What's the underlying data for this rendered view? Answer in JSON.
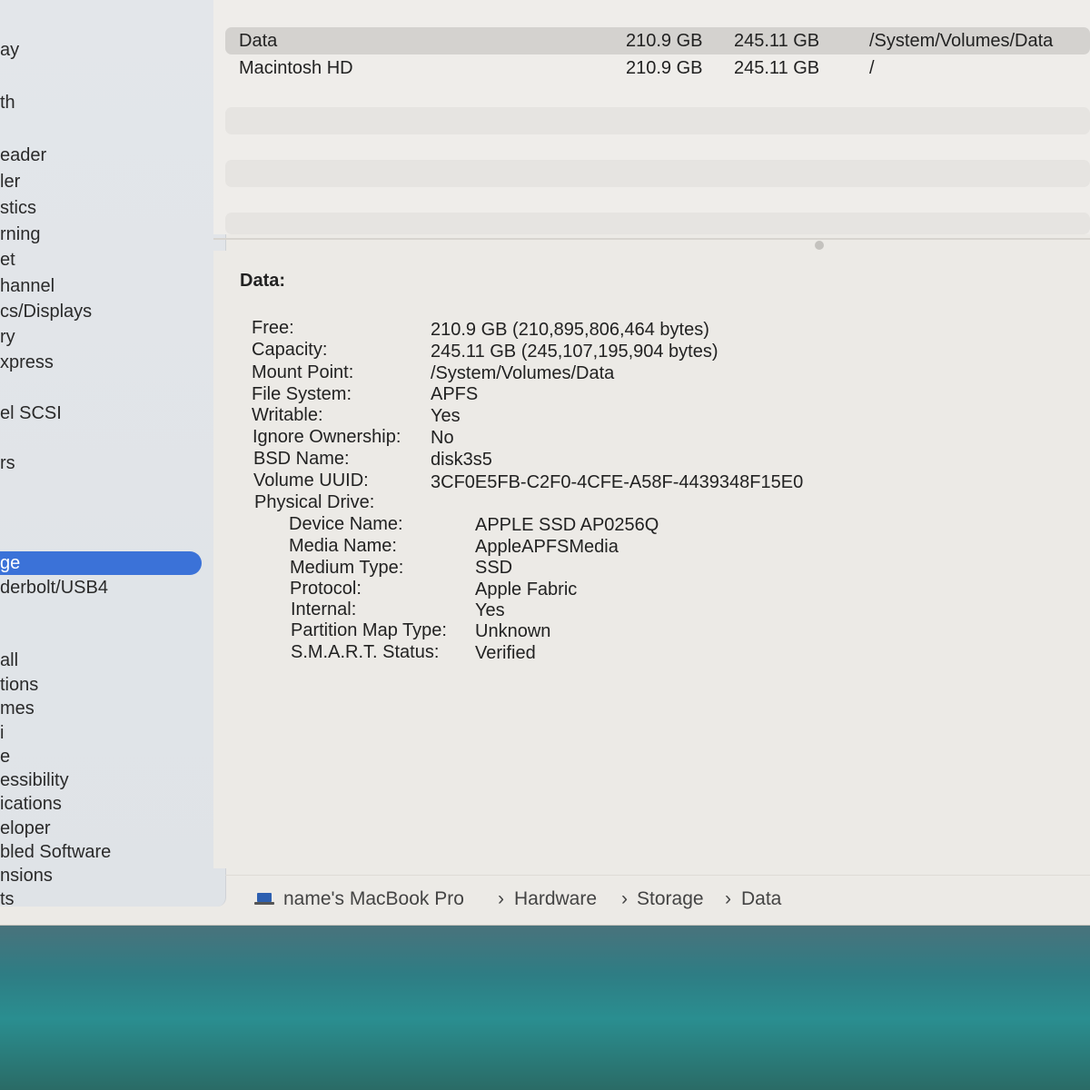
{
  "sidebar": {
    "items": [
      {
        "label": "ay"
      },
      {
        "label": "th"
      },
      {
        "label": "eader"
      },
      {
        "label": "ler"
      },
      {
        "label": "stics"
      },
      {
        "label": "rning"
      },
      {
        "label": "et"
      },
      {
        "label": "hannel"
      },
      {
        "label": "cs/Displays"
      },
      {
        "label": "ry"
      },
      {
        "label": "xpress"
      },
      {
        "label": "el SCSI"
      },
      {
        "label": "rs"
      },
      {
        "label": "ge"
      },
      {
        "label": "derbolt/USB4"
      },
      {
        "label": "all"
      },
      {
        "label": "tions"
      },
      {
        "label": "mes"
      },
      {
        "label": "i"
      },
      {
        "label": "e"
      },
      {
        "label": "essibility"
      },
      {
        "label": "ications"
      },
      {
        "label": "eloper"
      },
      {
        "label": "bled Software"
      },
      {
        "label": "nsions"
      },
      {
        "label": "ts"
      }
    ]
  },
  "volumes": {
    "rows": [
      {
        "name": "Data",
        "free": "210.9 GB",
        "capacity": "245.11 GB",
        "mount": "/System/Volumes/Data"
      },
      {
        "name": "Macintosh HD",
        "free": "210.9 GB",
        "capacity": "245.11 GB",
        "mount": "/"
      }
    ]
  },
  "detail": {
    "title": "Data:",
    "props": [
      {
        "label": "Free:",
        "value": "210.9 GB (210,895,806,464 bytes)"
      },
      {
        "label": "Capacity:",
        "value": "245.11 GB (245,107,195,904 bytes)"
      },
      {
        "label": "Mount Point:",
        "value": "/System/Volumes/Data"
      },
      {
        "label": "File System:",
        "value": "APFS"
      },
      {
        "label": "Writable:",
        "value": "Yes"
      },
      {
        "label": "Ignore Ownership:",
        "value": "No"
      },
      {
        "label": "BSD Name:",
        "value": "disk3s5"
      },
      {
        "label": "Volume UUID:",
        "value": "3CF0E5FB-C2F0-4CFE-A58F-4439348F15E0"
      },
      {
        "label": "Physical Drive:",
        "value": ""
      }
    ],
    "drive_props": [
      {
        "label": "Device Name:",
        "value": "APPLE SSD AP0256Q"
      },
      {
        "label": "Media Name:",
        "value": "AppleAPFSMedia"
      },
      {
        "label": "Medium Type:",
        "value": "SSD"
      },
      {
        "label": "Protocol:",
        "value": "Apple Fabric"
      },
      {
        "label": "Internal:",
        "value": "Yes"
      },
      {
        "label": "Partition Map Type:",
        "value": "Unknown"
      },
      {
        "label": "S.M.A.R.T. Status:",
        "value": "Verified"
      }
    ]
  },
  "pathbar": {
    "computer": "name's MacBook Pro",
    "sep": "›",
    "crumb1": "Hardware",
    "crumb2": "Storage",
    "crumb3": "Data"
  },
  "colors": {
    "selection": "#3b72d8"
  }
}
